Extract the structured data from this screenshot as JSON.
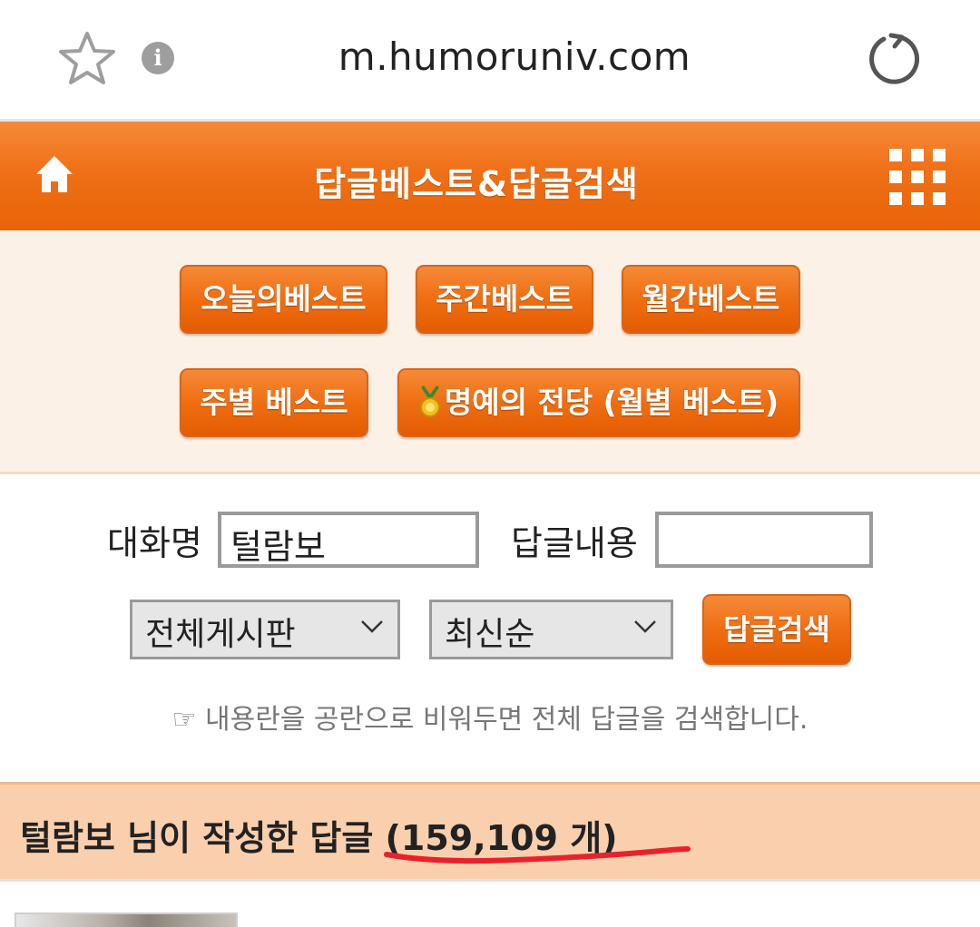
{
  "browser": {
    "url": "m.humoruniv.com"
  },
  "header": {
    "title": "답글베스트&답글검색"
  },
  "best_buttons": {
    "today": "오늘의베스트",
    "weekly": "주간베스트",
    "monthly": "월간베스트",
    "by_week": "주별 베스트",
    "hall_of_fame": "명예의 전당 (월별 베스트)"
  },
  "search": {
    "nickname_label": "대화명",
    "nickname_value": "털람보",
    "content_label": "답글내용",
    "content_value": "",
    "board_select": "전체게시판",
    "order_select": "최신순",
    "submit_label": "답글검색",
    "hint": "☞ 내용란을 공란으로 비워두면 전체 답글을 검색합니다."
  },
  "result": {
    "title": "털람보 님이 작성한 답글 (159,109 개)"
  },
  "colors": {
    "accent": "#ef6e12",
    "panel_bg": "#fcf1e7",
    "banner_bg": "#f9cfae",
    "annotation": "#e8222a"
  }
}
